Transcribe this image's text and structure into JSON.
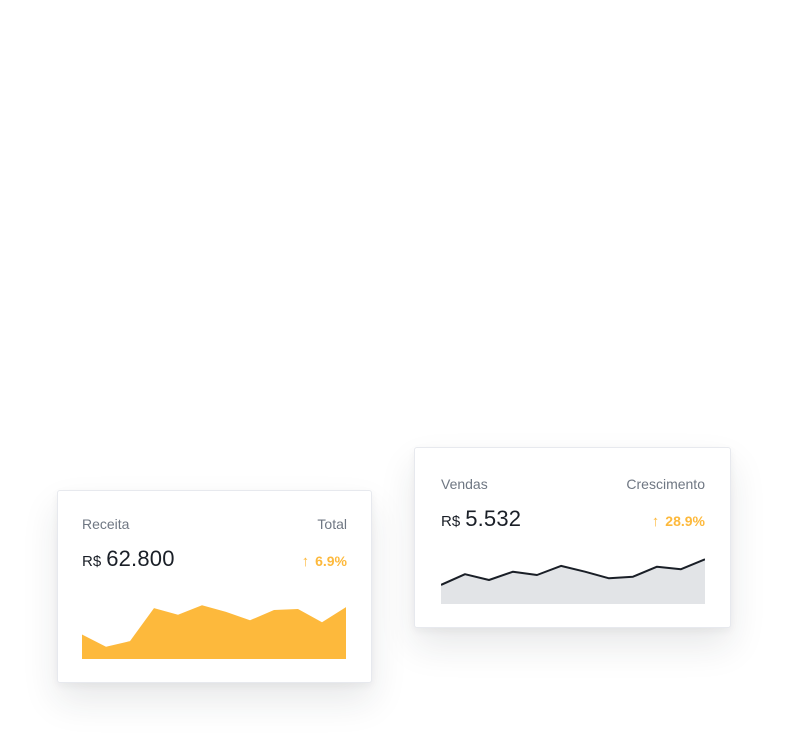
{
  "colors": {
    "accent": "#FDB93C",
    "line": "#1a1f27",
    "area_gray": "#E2E4E7",
    "muted_text": "#6f7783"
  },
  "cards": [
    {
      "title": "Receita",
      "right_label": "Total",
      "currency": "R$",
      "amount": "62.800",
      "growth": "6.9%",
      "arrow_icon": "arrow-up-icon"
    },
    {
      "title": "Vendas",
      "right_label": "Crescimento",
      "currency": "R$",
      "amount": "5.532",
      "growth": "28.9%",
      "arrow_icon": "arrow-up-icon"
    }
  ],
  "chart_data": [
    {
      "type": "area",
      "x": [
        0,
        1,
        2,
        3,
        4,
        5,
        6,
        7,
        8,
        9,
        10,
        11
      ],
      "values": [
        26,
        13,
        19,
        54,
        47,
        57,
        50,
        41,
        52,
        53,
        39,
        55
      ],
      "ylim": [
        0,
        70
      ],
      "grid": false,
      "color": "#FDB93C"
    },
    {
      "type": "area",
      "x": [
        0,
        1,
        2,
        3,
        4,
        5,
        6,
        7,
        8,
        9,
        10,
        11
      ],
      "values": [
        23,
        36,
        29,
        39,
        35,
        46,
        39,
        31,
        33,
        45,
        42,
        54
      ],
      "ylim": [
        0,
        70
      ],
      "grid": false,
      "line_color": "#1a1f27",
      "color": "#E2E4E7"
    }
  ]
}
